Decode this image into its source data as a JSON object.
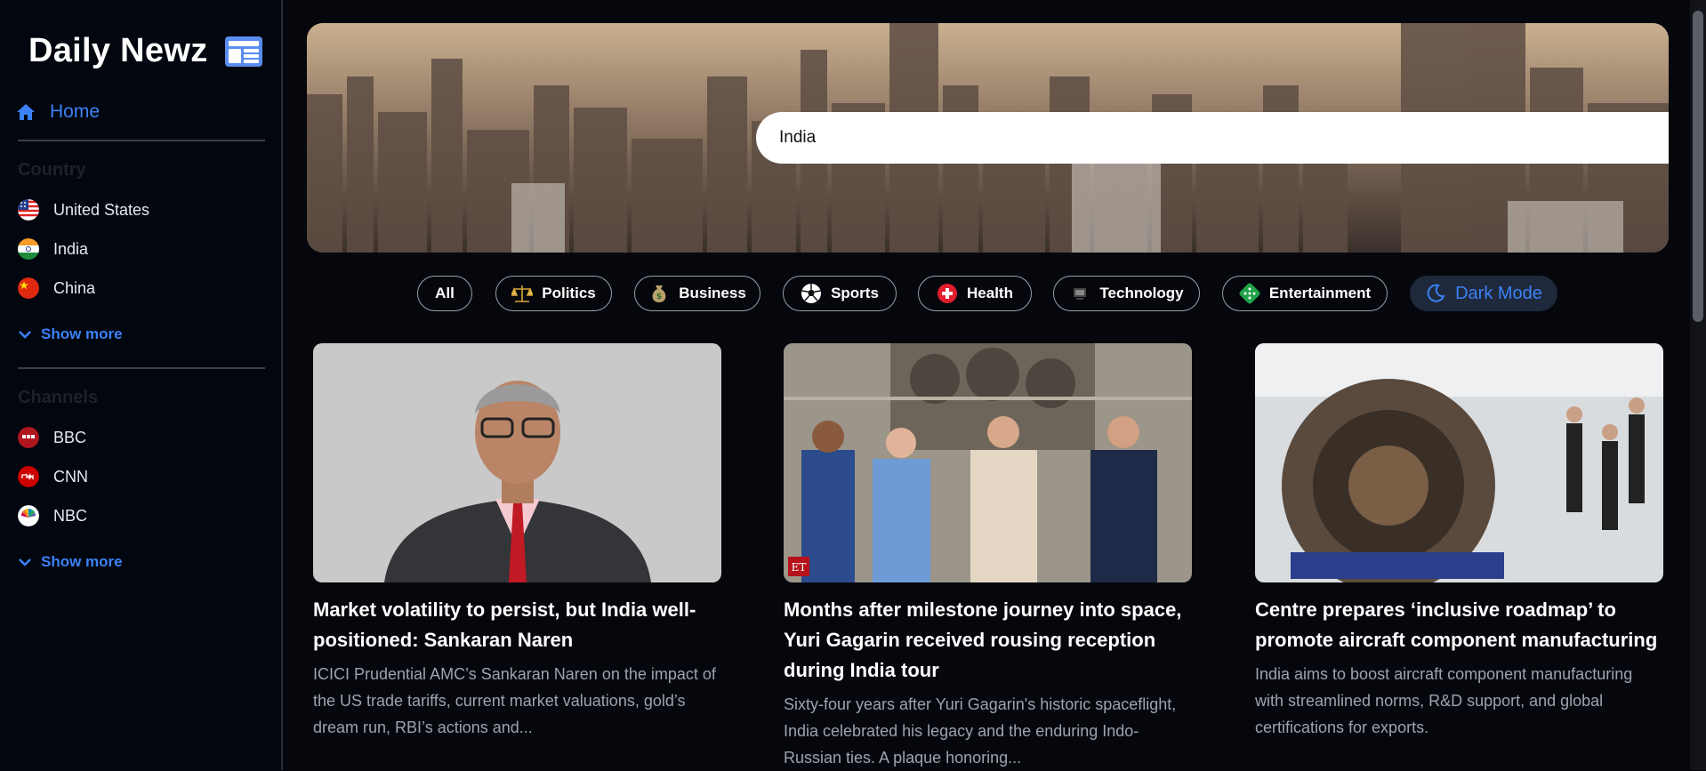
{
  "brand": {
    "name": "Daily Newz",
    "icon": "newspaper-icon"
  },
  "nav": {
    "home_label": "Home",
    "home_icon": "home-icon"
  },
  "countries": {
    "title": "Country",
    "items": [
      {
        "label": "United States",
        "icon": "us-flag-icon"
      },
      {
        "label": "India",
        "icon": "india-flag-icon"
      },
      {
        "label": "China",
        "icon": "china-flag-icon"
      }
    ],
    "show_more": "Show more"
  },
  "channels": {
    "title": "Channels",
    "items": [
      {
        "label": "BBC",
        "icon": "bbc-logo-icon"
      },
      {
        "label": "CNN",
        "icon": "cnn-logo-icon"
      },
      {
        "label": "NBC",
        "icon": "nbc-logo-icon"
      }
    ],
    "show_more": "Show more"
  },
  "search": {
    "value": "India",
    "icon": "search-icon"
  },
  "categories": [
    {
      "label": "All"
    },
    {
      "label": "Politics",
      "icon": "scales-icon"
    },
    {
      "label": "Business",
      "icon": "money-bag-icon"
    },
    {
      "label": "Sports",
      "icon": "soccer-ball-icon"
    },
    {
      "label": "Health",
      "icon": "medical-cross-icon"
    },
    {
      "label": "Technology",
      "icon": "computer-icon"
    },
    {
      "label": "Entertainment",
      "icon": "dice-icon"
    },
    {
      "label": "Dark Mode",
      "icon": "moon-icon"
    }
  ],
  "articles": [
    {
      "title": "Market volatility to persist, but India well-positioned: Sankaran Naren",
      "description": "ICICI Prudential AMC’s Sankaran Naren on the impact of the US trade tariffs, current market valuations, gold’s dream run, RBI’s actions and..."
    },
    {
      "title": "Months after milestone journey into space, Yuri Gagarin received rousing reception during India tour",
      "description": "Sixty-four years after Yuri Gagarin's historic spaceflight, India celebrated his legacy and the enduring Indo-Russian ties. A plaque honoring...",
      "image_badge": "ET"
    },
    {
      "title": "Centre prepares ‘inclusive roadmap’ to promote aircraft component manufacturing",
      "description": "India aims to boost aircraft component manufacturing with streamlined norms, R&D support, and global certifications for exports."
    }
  ],
  "colors": {
    "accent": "#3b82f6",
    "background": "#05070d",
    "sidebar": "#02060f"
  }
}
